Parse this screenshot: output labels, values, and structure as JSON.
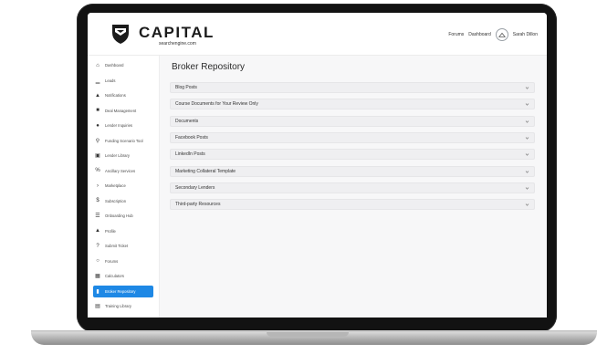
{
  "brand": {
    "name": "CAPITAL",
    "sub": "searchengine.com"
  },
  "topnav": {
    "forums": "Forums",
    "dashboard": "Dashboard",
    "user": "Sarah Dillon"
  },
  "sidebar": {
    "items": [
      {
        "label": "Dashboard",
        "icon": "home-icon",
        "glyph": "⌂"
      },
      {
        "label": "Leads",
        "icon": "bar-chart-icon",
        "glyph": "▁"
      },
      {
        "label": "Notifications",
        "icon": "bell-icon",
        "glyph": "▲"
      },
      {
        "label": "Deal Management",
        "icon": "document-icon",
        "glyph": "■"
      },
      {
        "label": "Lender Inquiries",
        "icon": "chat-icon",
        "glyph": "●"
      },
      {
        "label": "Funding Scenario Tool",
        "icon": "search-icon",
        "glyph": "⚲"
      },
      {
        "label": "Lender Library",
        "icon": "book-icon",
        "glyph": "▣"
      },
      {
        "label": "Ancillary Services",
        "icon": "percent-icon",
        "glyph": "%"
      },
      {
        "label": "Marketplace",
        "icon": "chevron-right-icon",
        "glyph": "›"
      },
      {
        "label": "Subscription",
        "icon": "dollar-icon",
        "glyph": "$"
      },
      {
        "label": "Onboarding Hub",
        "icon": "list-icon",
        "glyph": "☰"
      },
      {
        "label": "Profile",
        "icon": "user-icon",
        "glyph": "▲"
      },
      {
        "label": "Submit Ticket",
        "icon": "question-icon",
        "glyph": "?"
      },
      {
        "label": "Forums",
        "icon": "forum-icon",
        "glyph": "○"
      },
      {
        "label": "Calculators",
        "icon": "calculator-icon",
        "glyph": "▦"
      },
      {
        "label": "Broker Repository",
        "icon": "bookmark-icon",
        "glyph": "▮",
        "active": true
      },
      {
        "label": "Training Library",
        "icon": "library-icon",
        "glyph": "▤"
      }
    ]
  },
  "main": {
    "title": "Broker Repository",
    "sections": [
      "Blog Posts",
      "Course Documents for Your Review Only",
      "Documents",
      "Facebook Posts",
      "LinkedIn Posts",
      "Marketing Collateral Template",
      "Secondary Lenders",
      "Third-party Resources"
    ]
  },
  "colors": {
    "accent": "#1e88e5",
    "row_bg": "#efeff1"
  }
}
